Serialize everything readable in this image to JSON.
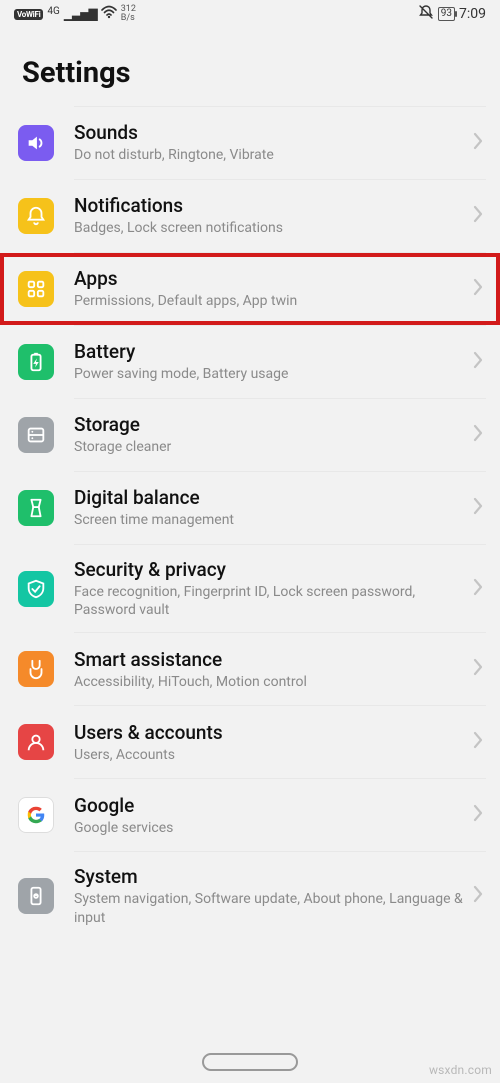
{
  "status": {
    "vowifi": "VoWiFi",
    "net_label": "4G",
    "speed_top": "312",
    "speed_bottom": "B/s",
    "battery": "93",
    "time": "7:09"
  },
  "header": {
    "title": "Settings"
  },
  "items": [
    {
      "icon": "sounds",
      "color": "#7b5cf0",
      "title": "Sounds",
      "subtitle": "Do not disturb, Ringtone, Vibrate",
      "highlight": false
    },
    {
      "icon": "notifications",
      "color": "#f6c21a",
      "title": "Notifications",
      "subtitle": "Badges, Lock screen notifications",
      "highlight": false
    },
    {
      "icon": "apps",
      "color": "#f6c21a",
      "title": "Apps",
      "subtitle": "Permissions, Default apps, App twin",
      "highlight": true
    },
    {
      "icon": "battery",
      "color": "#1fbf6b",
      "title": "Battery",
      "subtitle": "Power saving mode, Battery usage",
      "highlight": false
    },
    {
      "icon": "storage",
      "color": "#9fa4a9",
      "title": "Storage",
      "subtitle": "Storage cleaner",
      "highlight": false
    },
    {
      "icon": "digital",
      "color": "#1fbf6b",
      "title": "Digital balance",
      "subtitle": "Screen time management",
      "highlight": false
    },
    {
      "icon": "security",
      "color": "#14c6a3",
      "title": "Security & privacy",
      "subtitle": "Face recognition, Fingerprint ID, Lock screen password, Password vault",
      "highlight": false
    },
    {
      "icon": "smart",
      "color": "#f58a2a",
      "title": "Smart assistance",
      "subtitle": "Accessibility, HiTouch, Motion control",
      "highlight": false
    },
    {
      "icon": "users",
      "color": "#e64545",
      "title": "Users & accounts",
      "subtitle": "Users, Accounts",
      "highlight": false
    },
    {
      "icon": "google",
      "color": "#ffffff",
      "title": "Google",
      "subtitle": "Google services",
      "highlight": false
    },
    {
      "icon": "system",
      "color": "#9fa4a9",
      "title": "System",
      "subtitle": "System navigation, Software update, About phone, Language & input",
      "highlight": false
    }
  ],
  "watermark": "wsxdn.com"
}
